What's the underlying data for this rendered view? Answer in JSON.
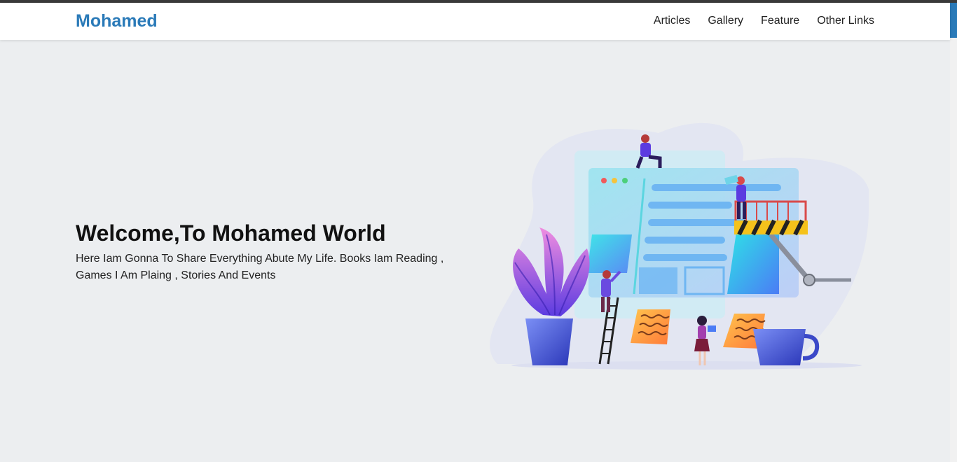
{
  "brand": {
    "name": "Mohamed",
    "color": "#2a7ab8"
  },
  "nav": {
    "items": [
      {
        "label": "Articles"
      },
      {
        "label": "Gallery"
      },
      {
        "label": "Feature"
      },
      {
        "label": "Other Links"
      }
    ]
  },
  "hero": {
    "title": "Welcome,To Mohamed World",
    "description": "Here Iam Gonna To Share Everything Abute My Life. Books Iam Reading , Games I Am Plaing , Stories And Events"
  },
  "colors": {
    "background": "#eceef0",
    "accent": "#2a7ab8"
  },
  "illustration": {
    "icon": "web-design-team-illustration"
  }
}
